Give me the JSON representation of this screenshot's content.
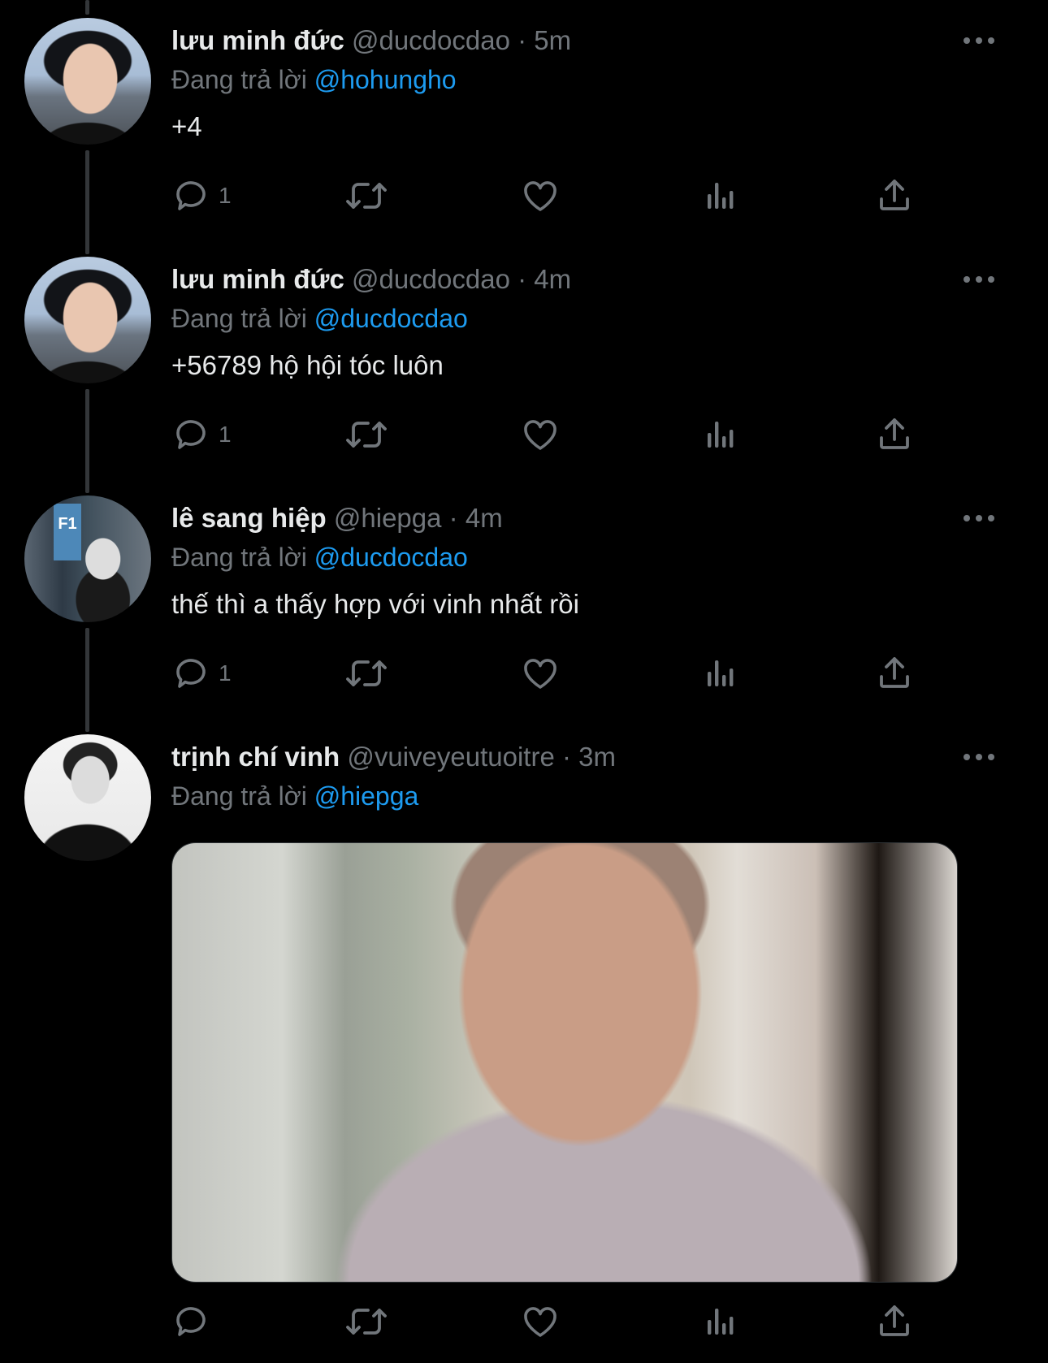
{
  "tweets": [
    {
      "name": "lưu minh đức",
      "handle": "@ducdocdao",
      "dot": "·",
      "time": "5m",
      "reply_prefix": "Đang trả lời",
      "reply_to": "@hohungho",
      "text": "+4",
      "reply_count": "1",
      "avatar": "profile-photo-young-man"
    },
    {
      "name": "lưu minh đức",
      "handle": "@ducdocdao",
      "dot": "·",
      "time": "4m",
      "reply_prefix": "Đang trả lời",
      "reply_to": "@ducdocdao",
      "text": "+56789 hộ hội tóc luôn",
      "reply_count": "1",
      "avatar": "profile-photo-young-man"
    },
    {
      "name": "lê sang hiệp",
      "handle": "@hiepga",
      "dot": "·",
      "time": "4m",
      "reply_prefix": "Đang trả lời",
      "reply_to": "@ducdocdao",
      "text": "thế thì a thấy hợp với vinh nhất rồi",
      "reply_count": "1",
      "avatar": "profile-photo-parking-garage",
      "avatar_sign": "F1"
    },
    {
      "name": "trịnh chí vinh",
      "handle": "@vuiveyeutuoitre",
      "dot": "·",
      "time": "3m",
      "reply_prefix": "Đang trả lời",
      "reply_to": "@hiepga",
      "text": "",
      "reply_count": "",
      "avatar": "profile-photo-black-white",
      "media": "photo-crying-monk-praying"
    }
  ],
  "colors": {
    "background": "#000000",
    "text_primary": "#e7e9ea",
    "text_secondary": "#71767b",
    "accent_link": "#1d9bf0",
    "thread_line": "#333639"
  },
  "icons": [
    "reply-icon",
    "retweet-icon",
    "like-icon",
    "views-icon",
    "share-icon",
    "more-icon"
  ]
}
